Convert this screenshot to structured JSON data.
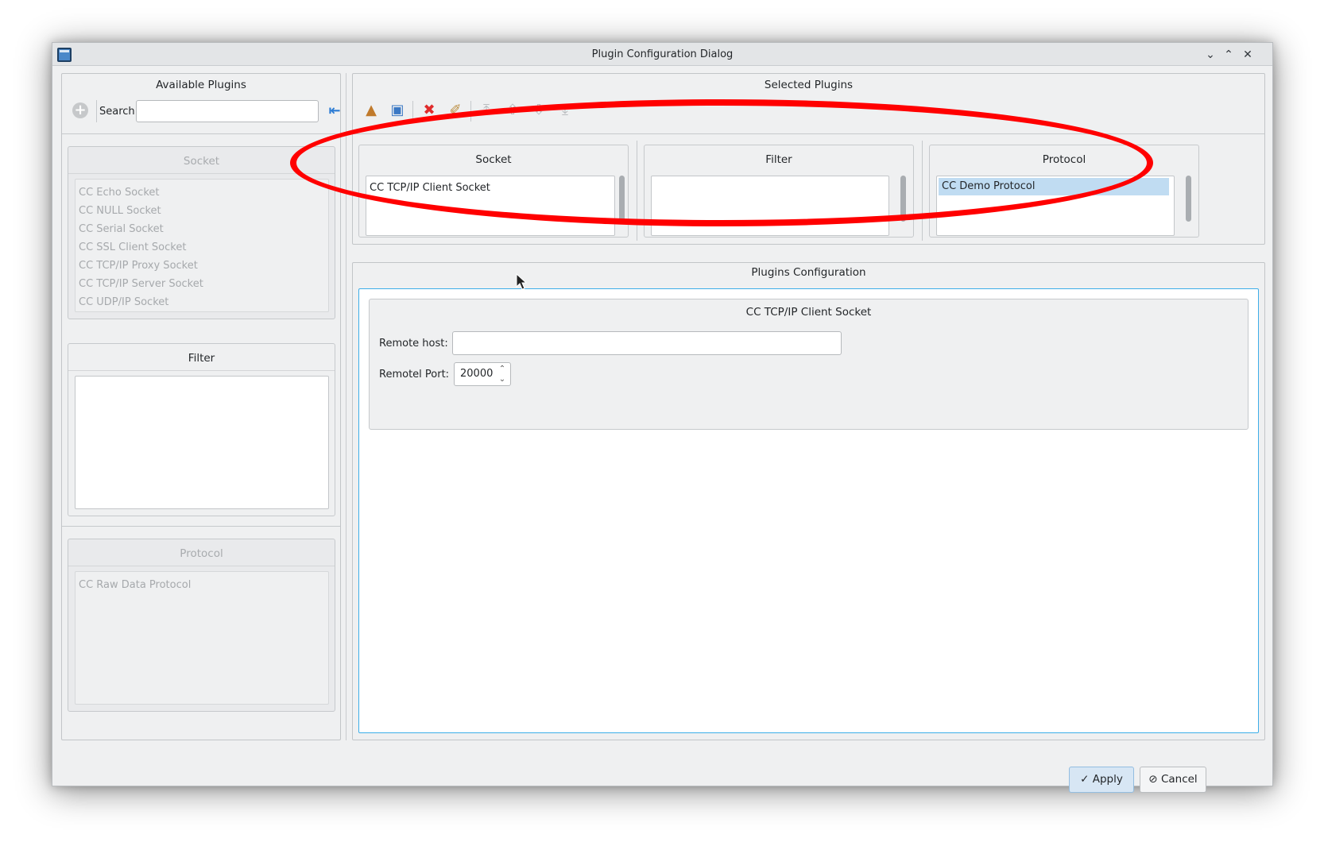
{
  "window": {
    "title": "Plugin Configuration Dialog"
  },
  "available": {
    "title": "Available Plugins",
    "search_label": "Search:",
    "search_value": "",
    "socket_group": {
      "title": "Socket",
      "items": [
        "CC Echo Socket",
        "CC NULL Socket",
        "CC Serial Socket",
        "CC SSL Client Socket",
        "CC TCP/IP Proxy Socket",
        "CC TCP/IP Server Socket",
        "CC UDP/IP Socket"
      ]
    },
    "filter_group": {
      "title": "Filter",
      "items": []
    },
    "protocol_group": {
      "title": "Protocol",
      "items": [
        "CC Raw Data Protocol"
      ]
    }
  },
  "selected": {
    "title": "Selected Plugins",
    "toolbar": [
      "load-config-icon",
      "save-config-icon",
      "remove-plugin-icon",
      "clear-all-icon",
      "move-top-icon",
      "move-up-icon",
      "move-down-icon",
      "move-bottom-icon"
    ],
    "socket": {
      "title": "Socket",
      "items": [
        "CC TCP/IP Client Socket"
      ]
    },
    "filter": {
      "title": "Filter",
      "items": []
    },
    "protocol": {
      "title": "Protocol",
      "items": [
        "CC Demo Protocol"
      ],
      "selected_index": 0
    }
  },
  "config": {
    "title": "Plugins Configuration",
    "plugin_title": "CC TCP/IP Client Socket",
    "remote_host_label": "Remote host:",
    "remote_host_value": "",
    "remote_port_label": "Remotel Port:",
    "remote_port_value": "20000"
  },
  "buttons": {
    "apply": "Apply",
    "cancel": "Cancel"
  },
  "colors": {
    "annotation": "#ff0000",
    "selection": "#c0dcf2",
    "accent": "#3daee9"
  }
}
